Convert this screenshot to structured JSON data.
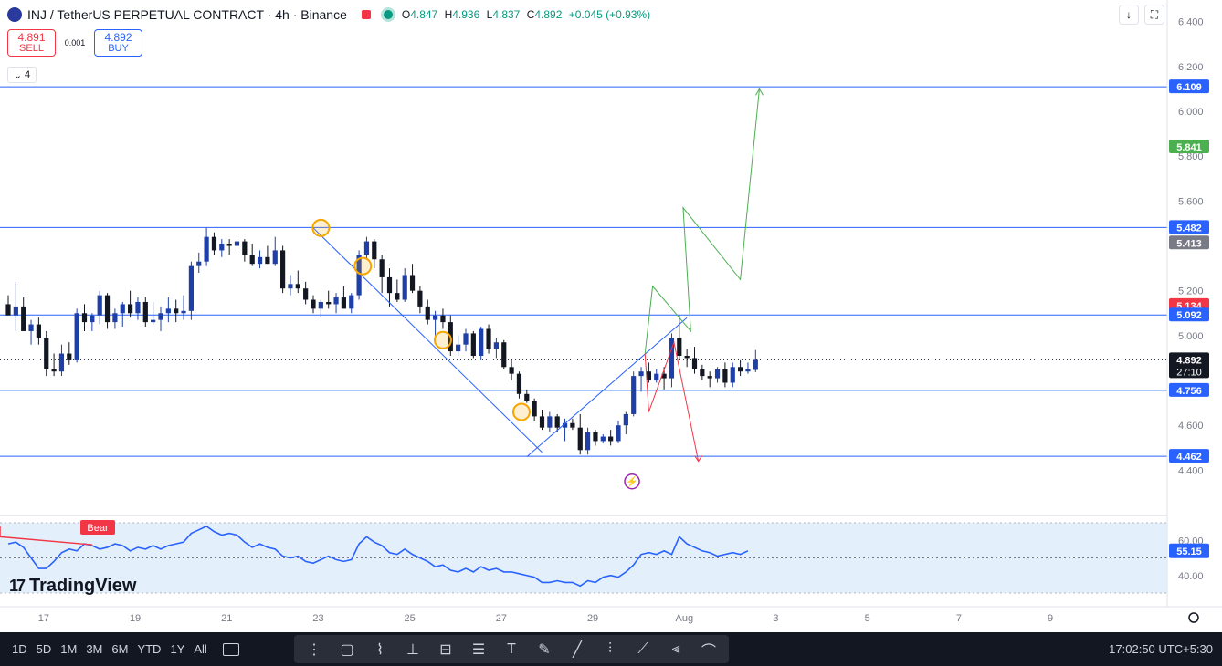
{
  "header": {
    "title": "INJ / TetherUS PERPETUAL CONTRACT · 4h · Binance",
    "open_label": "O",
    "open": "4.847",
    "high_label": "H",
    "high": "4.936",
    "low_label": "L",
    "low": "4.837",
    "close_label": "C",
    "close": "4.892",
    "change": "+0.045 (+0.93%)"
  },
  "trade": {
    "sell_price": "4.891",
    "sell_label": "SELL",
    "spread": "0.001",
    "buy_price": "4.892",
    "buy_label": "BUY"
  },
  "indicator_count": "4",
  "colors": {
    "up": "#1e3fa8",
    "down": "#131722",
    "hline": "#2962ff",
    "green": "#4caf50",
    "red": "#f23645",
    "rsi": "#2962ff",
    "rsi_band": "#e3f0fb",
    "highlight": "#f7a600"
  },
  "chart_data": {
    "type": "candlestick",
    "symbol": "INJ / TetherUS PERPETUAL CONTRACT",
    "timeframe": "4h",
    "exchange": "Binance",
    "ylim": [
      4.3,
      6.5
    ],
    "y_ticks": [
      "6.400",
      "6.200",
      "6.000",
      "5.800",
      "5.600",
      "5.200",
      "5.000",
      "4.600",
      "4.400"
    ],
    "x_ticks": [
      {
        "label": "17",
        "t": 2.5
      },
      {
        "label": "19",
        "t": 14.5
      },
      {
        "label": "21",
        "t": 26.5
      },
      {
        "label": "23",
        "t": 38.5
      },
      {
        "label": "25",
        "t": 50.5
      },
      {
        "label": "27",
        "t": 62.5
      },
      {
        "label": "29",
        "t": 74.5
      },
      {
        "label": "Aug",
        "t": 86.5
      },
      {
        "label": "3",
        "t": 98.5
      },
      {
        "label": "5",
        "t": 110.5
      },
      {
        "label": "7",
        "t": 122.5
      },
      {
        "label": "9",
        "t": 134.5
      }
    ],
    "candles": [
      [
        5.14,
        5.18,
        5.1,
        5.09
      ],
      [
        5.09,
        5.24,
        5.02,
        5.13
      ],
      [
        5.13,
        5.17,
        5.04,
        5.02
      ],
      [
        5.02,
        5.07,
        4.96,
        5.05
      ],
      [
        5.05,
        5.08,
        4.96,
        4.99
      ],
      [
        4.99,
        5.02,
        4.82,
        4.85
      ],
      [
        4.85,
        4.92,
        4.82,
        4.84
      ],
      [
        4.84,
        4.96,
        4.82,
        4.92
      ],
      [
        4.92,
        4.97,
        4.87,
        4.89
      ],
      [
        4.89,
        5.12,
        4.88,
        5.1
      ],
      [
        5.1,
        5.14,
        5.02,
        5.06
      ],
      [
        5.06,
        5.1,
        5.02,
        5.09
      ],
      [
        5.09,
        5.2,
        5.05,
        5.18
      ],
      [
        5.18,
        5.19,
        5.03,
        5.06
      ],
      [
        5.06,
        5.12,
        5.03,
        5.1
      ],
      [
        5.1,
        5.15,
        5.04,
        5.14
      ],
      [
        5.14,
        5.2,
        5.08,
        5.1
      ],
      [
        5.1,
        5.17,
        5.07,
        5.15
      ],
      [
        5.15,
        5.17,
        5.04,
        5.06
      ],
      [
        5.06,
        5.15,
        5.05,
        5.07
      ],
      [
        5.07,
        5.13,
        5.02,
        5.1
      ],
      [
        5.1,
        5.17,
        5.06,
        5.12
      ],
      [
        5.12,
        5.16,
        5.06,
        5.1
      ],
      [
        5.1,
        5.18,
        5.07,
        5.11
      ],
      [
        5.11,
        5.33,
        5.07,
        5.31
      ],
      [
        5.31,
        5.37,
        5.28,
        5.33
      ],
      [
        5.33,
        5.48,
        5.31,
        5.44
      ],
      [
        5.44,
        5.46,
        5.36,
        5.38
      ],
      [
        5.38,
        5.43,
        5.35,
        5.41
      ],
      [
        5.41,
        5.43,
        5.36,
        5.4
      ],
      [
        5.4,
        5.43,
        5.36,
        5.42
      ],
      [
        5.42,
        5.43,
        5.33,
        5.36
      ],
      [
        5.36,
        5.41,
        5.31,
        5.32
      ],
      [
        5.32,
        5.38,
        5.3,
        5.35
      ],
      [
        5.35,
        5.4,
        5.32,
        5.32
      ],
      [
        5.32,
        5.44,
        5.31,
        5.38
      ],
      [
        5.38,
        5.4,
        5.19,
        5.21
      ],
      [
        5.21,
        5.27,
        5.18,
        5.23
      ],
      [
        5.23,
        5.29,
        5.19,
        5.21
      ],
      [
        5.21,
        5.24,
        5.14,
        5.16
      ],
      [
        5.16,
        5.18,
        5.1,
        5.12
      ],
      [
        5.12,
        5.16,
        5.08,
        5.15
      ],
      [
        5.15,
        5.2,
        5.12,
        5.14
      ],
      [
        5.14,
        5.19,
        5.1,
        5.17
      ],
      [
        5.17,
        5.22,
        5.12,
        5.12
      ],
      [
        5.12,
        5.19,
        5.1,
        5.18
      ],
      [
        5.18,
        5.38,
        5.16,
        5.36
      ],
      [
        5.36,
        5.44,
        5.34,
        5.42
      ],
      [
        5.42,
        5.43,
        5.3,
        5.34
      ],
      [
        5.34,
        5.36,
        5.19,
        5.26
      ],
      [
        5.26,
        5.3,
        5.13,
        5.19
      ],
      [
        5.19,
        5.25,
        5.15,
        5.16
      ],
      [
        5.16,
        5.3,
        5.15,
        5.27
      ],
      [
        5.27,
        5.32,
        5.19,
        5.2
      ],
      [
        5.2,
        5.22,
        5.1,
        5.13
      ],
      [
        5.13,
        5.16,
        5.05,
        5.07
      ],
      [
        5.07,
        5.11,
        5.0,
        5.09
      ],
      [
        5.09,
        5.12,
        5.03,
        5.06
      ],
      [
        5.06,
        5.09,
        4.91,
        4.93
      ],
      [
        4.93,
        5.0,
        4.91,
        4.96
      ],
      [
        4.96,
        5.03,
        4.93,
        5.01
      ],
      [
        5.01,
        5.02,
        4.9,
        4.91
      ],
      [
        4.91,
        5.04,
        4.89,
        5.03
      ],
      [
        5.03,
        5.05,
        4.92,
        4.94
      ],
      [
        4.94,
        4.99,
        4.9,
        4.97
      ],
      [
        4.97,
        4.98,
        4.85,
        4.86
      ],
      [
        4.86,
        4.89,
        4.8,
        4.83
      ],
      [
        4.83,
        4.84,
        4.72,
        4.74
      ],
      [
        4.74,
        4.76,
        4.7,
        4.71
      ],
      [
        4.71,
        4.72,
        4.62,
        4.64
      ],
      [
        4.64,
        4.67,
        4.58,
        4.59
      ],
      [
        4.59,
        4.66,
        4.57,
        4.64
      ],
      [
        4.64,
        4.65,
        4.57,
        4.59
      ],
      [
        4.59,
        4.63,
        4.53,
        4.61
      ],
      [
        4.61,
        4.63,
        4.58,
        4.59
      ],
      [
        4.59,
        4.65,
        4.47,
        4.49
      ],
      [
        4.49,
        4.59,
        4.47,
        4.57
      ],
      [
        4.57,
        4.58,
        4.51,
        4.53
      ],
      [
        4.53,
        4.56,
        4.52,
        4.55
      ],
      [
        4.55,
        4.58,
        4.51,
        4.53
      ],
      [
        4.53,
        4.62,
        4.52,
        4.6
      ],
      [
        4.6,
        4.66,
        4.56,
        4.65
      ],
      [
        4.65,
        4.84,
        4.64,
        4.82
      ],
      [
        4.82,
        4.86,
        4.75,
        4.84
      ],
      [
        4.84,
        4.88,
        4.79,
        4.8
      ],
      [
        4.8,
        4.85,
        4.79,
        4.83
      ],
      [
        4.83,
        4.86,
        4.76,
        4.81
      ],
      [
        4.81,
        5.01,
        4.77,
        4.99
      ],
      [
        4.99,
        5.09,
        4.89,
        4.91
      ],
      [
        4.91,
        4.94,
        4.86,
        4.9
      ],
      [
        4.9,
        4.95,
        4.83,
        4.85
      ],
      [
        4.85,
        4.87,
        4.8,
        4.82
      ],
      [
        4.82,
        4.84,
        4.77,
        4.81
      ],
      [
        4.81,
        4.86,
        4.79,
        4.85
      ],
      [
        4.85,
        4.88,
        4.77,
        4.79
      ],
      [
        4.79,
        4.88,
        4.77,
        4.86
      ],
      [
        4.86,
        4.89,
        4.82,
        4.84
      ],
      [
        4.84,
        4.88,
        4.83,
        4.85
      ],
      [
        4.847,
        4.936,
        4.837,
        4.892
      ]
    ],
    "horizontal_lines": [
      6.109,
      5.482,
      5.092,
      4.756,
      4.462
    ],
    "price_labels": [
      {
        "value": "6.109",
        "price": 6.109,
        "color": "#2962ff"
      },
      {
        "value": "5.841",
        "price": 5.841,
        "color": "#4caf50"
      },
      {
        "value": "5.482",
        "price": 5.482,
        "color": "#2962ff"
      },
      {
        "value": "5.413",
        "price": 5.413,
        "color": "#787b86"
      },
      {
        "value": "5.134",
        "price": 5.134,
        "color": "#f23645"
      },
      {
        "value": "5.092",
        "price": 5.092,
        "color": "#2962ff"
      },
      {
        "value": "4.892",
        "price": 4.892,
        "color": "#131722",
        "sub": "27:10"
      },
      {
        "value": "4.756",
        "price": 4.756,
        "color": "#2962ff"
      },
      {
        "value": "4.462",
        "price": 4.462,
        "color": "#2962ff"
      }
    ],
    "current_price": 4.892,
    "trendlines": [
      {
        "from": [
          40.0,
          5.48
        ],
        "to": [
          70.0,
          4.48
        ]
      },
      {
        "from": [
          68.0,
          4.46
        ],
        "to": [
          89.0,
          5.08
        ]
      }
    ],
    "highlight_points": [
      [
        41.0,
        5.48
      ],
      [
        46.5,
        5.31
      ],
      [
        57.0,
        4.98
      ],
      [
        67.3,
        4.66
      ]
    ],
    "projection_green": [
      [
        83.5,
        4.92
      ],
      [
        84.5,
        5.22
      ],
      [
        89.5,
        5.02
      ],
      [
        88.5,
        5.57
      ],
      [
        96.0,
        5.25
      ],
      [
        98.5,
        6.1
      ]
    ],
    "projection_red": [
      [
        83.5,
        4.92
      ],
      [
        84.0,
        4.66
      ],
      [
        87.3,
        4.97
      ],
      [
        90.5,
        4.44
      ]
    ],
    "lightning_marker": [
      81.8,
      4.35
    ],
    "rsi": {
      "ylim": [
        30,
        70
      ],
      "ticks": [
        "60.00",
        "40.00"
      ],
      "band": [
        30,
        70
      ],
      "mid_line": 50,
      "current": "55.15",
      "divergence_label": "Bear",
      "values": [
        58,
        59,
        56,
        50,
        44,
        44,
        48,
        53,
        55,
        54,
        58,
        57,
        55,
        56,
        58,
        57,
        54,
        56,
        55,
        57,
        55,
        57,
        58,
        59,
        64,
        66,
        68,
        65,
        63,
        64,
        63,
        59,
        56,
        58,
        56,
        55,
        51,
        50,
        51,
        48,
        47,
        49,
        51,
        49,
        48,
        49,
        58,
        62,
        59,
        57,
        53,
        52,
        55,
        52,
        50,
        48,
        45,
        46,
        43,
        42,
        44,
        42,
        45,
        43,
        44,
        42,
        42,
        41,
        40,
        39,
        36,
        36,
        37,
        36,
        36,
        34,
        37,
        36,
        39,
        40,
        39,
        42,
        46,
        52,
        53,
        52,
        54,
        52,
        62,
        58,
        56,
        54,
        53,
        51,
        52,
        53,
        52,
        54
      ]
    }
  },
  "bottom": {
    "ranges": [
      "1D",
      "5D",
      "1M",
      "3M",
      "6M",
      "YTD",
      "1Y",
      "All"
    ],
    "clock": "17:02:50 UTC+5:30"
  },
  "logo": "TradingView"
}
